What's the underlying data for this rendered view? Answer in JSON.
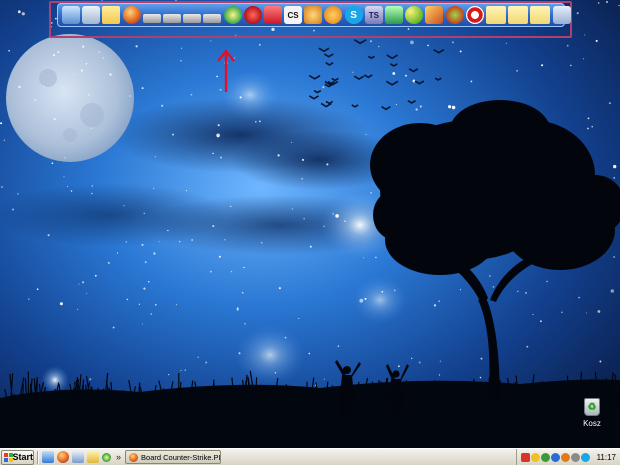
{
  "taskbar": {
    "start_label": "Start",
    "task_title": "Board Counter-Strike.PL ...",
    "clock": "11:17",
    "quick_launch_more": "»"
  },
  "desktop": {
    "recycle_bin_label": "Kosz"
  },
  "dock": {
    "icons": [
      "computer-icon",
      "recycle-icon",
      "folder-icon",
      "firefox-icon",
      "drive-icon",
      "drive-icon",
      "drive-icon",
      "drive-icon",
      "audio-icon",
      "media-player-icon",
      "gift-icon",
      "counter-strike-icon",
      "contacts-icon",
      "sun-icon",
      "skype-icon",
      "text-editor-icon",
      "monitor-icon",
      "molecule-icon",
      "paint-icon",
      "games-icon",
      "lifebuoy-icon",
      "folder-icon",
      "folder-icon",
      "folder-icon",
      "settings-icon"
    ],
    "skype_glyph": "S",
    "cs_glyph": "CS",
    "ts_glyph": "TS"
  },
  "colors": {
    "annotation": "#e0102a",
    "dock_frame": "#b2406e",
    "sky_top": "#0a1f4e",
    "sky_mid": "#1a5fb0"
  }
}
